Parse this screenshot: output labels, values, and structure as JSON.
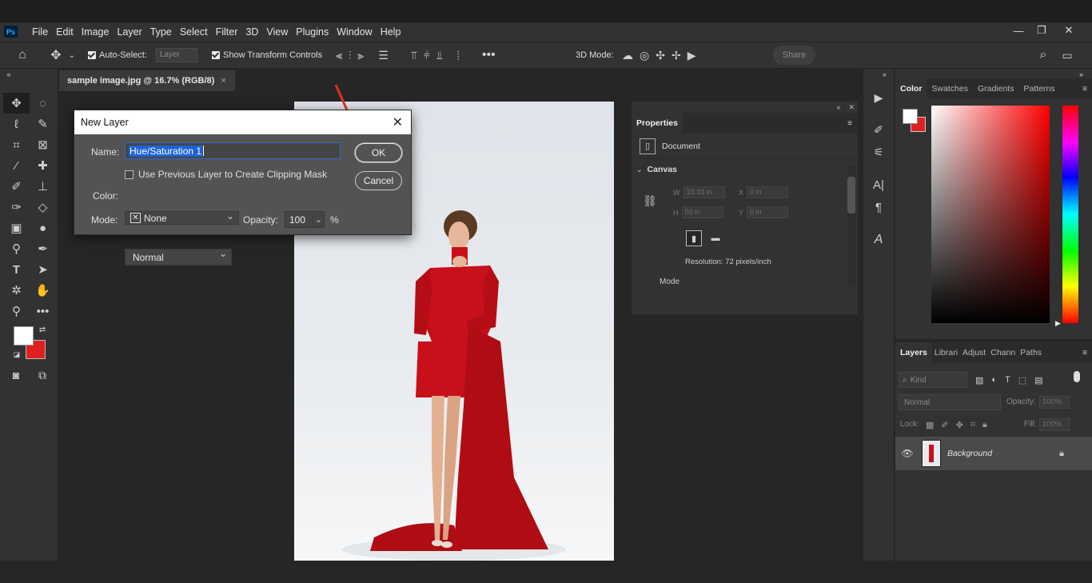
{
  "app": {
    "logo": "Ps",
    "menu": [
      "File",
      "Edit",
      "Image",
      "Layer",
      "Type",
      "Select",
      "Filter",
      "3D",
      "View",
      "Plugins",
      "Window",
      "Help"
    ]
  },
  "options_bar": {
    "auto_select_label": "Auto-Select:",
    "auto_select_value": "Layer",
    "show_transform_label": "Show Transform Controls",
    "mode_3d_label": "3D Mode:",
    "share_label": "Share"
  },
  "document_tab": {
    "title": "sample image.jpg @ 16.7% (RGB/8)",
    "close": "×"
  },
  "dialog": {
    "title": "New Layer",
    "name_label": "Name:",
    "name_value": "Hue/Saturation 1",
    "clip_label": "Use Previous Layer to Create Clipping Mask",
    "color_label": "Color:",
    "color_value": "None",
    "mode_label": "Mode:",
    "mode_value": "Normal",
    "opacity_label": "Opacity:",
    "opacity_value": "100",
    "opacity_unit": "%",
    "ok_label": "OK",
    "cancel_label": "Cancel"
  },
  "properties": {
    "tab": "Properties",
    "document_label": "Document",
    "canvas_label": "Canvas",
    "w_label": "W",
    "w_value": "33.33 in",
    "h_label": "H",
    "h_value": "50 in",
    "x_label": "X",
    "x_value": "0 in",
    "y_label": "Y",
    "y_value": "0 in",
    "resolution": "Resolution: 72 pixels/inch",
    "mode_label": "Mode"
  },
  "color_panel": {
    "tabs": [
      "Color",
      "Swatches",
      "Gradients",
      "Patterns"
    ],
    "foreground": "#ffffff",
    "background": "#e02020"
  },
  "layers_panel": {
    "tabs": [
      "Layers",
      "Librari",
      "Adjust",
      "Chann",
      "Paths"
    ],
    "kind_label": "Kind",
    "blend_mode": "Normal",
    "opacity_label": "Opacity:",
    "opacity_value": "100%",
    "lock_label": "Lock:",
    "fill_label": "Fill:",
    "fill_value": "100%",
    "layers": [
      {
        "name": "Background"
      }
    ]
  },
  "colors": {
    "accent_arrow": "#e0302a",
    "panel_bg": "#323232",
    "dress_red": "#c8101a"
  }
}
